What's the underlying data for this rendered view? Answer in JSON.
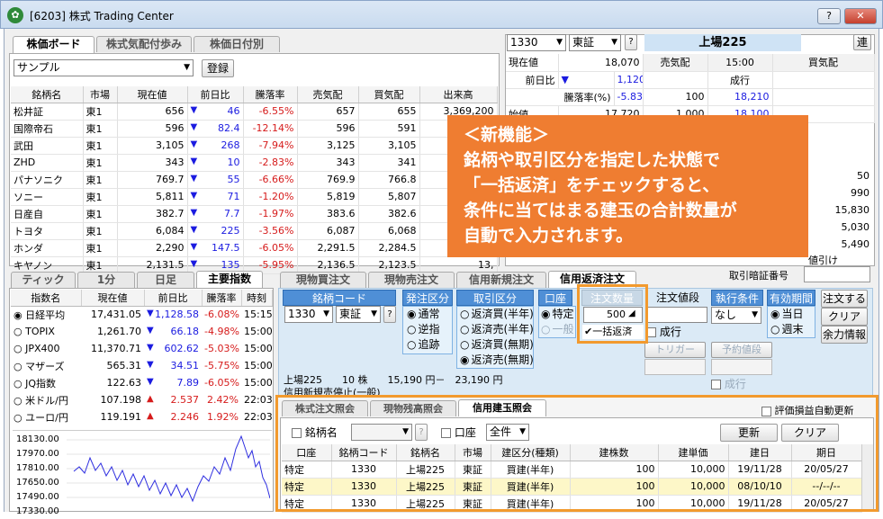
{
  "window": {
    "title": "[6203] 株式 Trading Center",
    "help": "?",
    "close": "✕"
  },
  "top_tabs": [
    "株価ボード",
    "株式気配付歩み",
    "株価日付別"
  ],
  "board": {
    "select": "サンプル",
    "register": "登録",
    "headers": [
      "銘柄名",
      "市場",
      "現在値",
      "前日比",
      "騰落率",
      "売気配",
      "買気配",
      "出来高"
    ],
    "rows": [
      [
        "松井証",
        "東1",
        "656",
        "▼",
        "46",
        "-6.55%",
        "657",
        "655",
        "3,369,200"
      ],
      [
        "国際帝石",
        "東1",
        "596",
        "▼",
        "82.4",
        "-12.14%",
        "596",
        "591",
        "28,"
      ],
      [
        "武田",
        "東1",
        "3,105",
        "▼",
        "268",
        "-7.94%",
        "3,125",
        "3,105",
        "19,"
      ],
      [
        "ZHD",
        "東1",
        "343",
        "▼",
        "10",
        "-2.83%",
        "343",
        "341",
        "37,"
      ],
      [
        "パナソニク",
        "東1",
        "769.7",
        "▼",
        "55",
        "-6.66%",
        "769.9",
        "766.8",
        "20,"
      ],
      [
        "ソニー",
        "東1",
        "5,811",
        "▼",
        "71",
        "-1.20%",
        "5,819",
        "5,807",
        "26,"
      ],
      [
        "日産自",
        "東1",
        "382.7",
        "▼",
        "7.7",
        "-1.97%",
        "383.6",
        "382.6",
        "50,"
      ],
      [
        "トヨタ",
        "東1",
        "6,084",
        "▼",
        "225",
        "-3.56%",
        "6,087",
        "6,068",
        "15,"
      ],
      [
        "ホンダ",
        "東1",
        "2,290",
        "▼",
        "147.5",
        "-6.05%",
        "2,291.5",
        "2,284.5",
        "14,"
      ],
      [
        "キヤノン",
        "東1",
        "2,131.5",
        "▼",
        "135",
        "-5.95%",
        "2,136.5",
        "2,123.5",
        "13,"
      ]
    ]
  },
  "quote": {
    "code": "1330",
    "market": "東証",
    "q": "?",
    "name": "上場225",
    "ren": "連",
    "h_cur": "現在値",
    "cur": "18,070",
    "sell_hdr": "売気配",
    "time": "15:00",
    "buy_hdr": "買気配",
    "prev_lbl": "前日比",
    "prev_mark": "▼",
    "prev": "1,120",
    "nari": "成行",
    "rate_lbl": "騰落率(%)",
    "rate": "-5.83%",
    "q1": "100",
    "p1": "18,210",
    "open_lbl": "始値",
    "open": "17,720",
    "q2": "1,000",
    "p2": "18,100",
    "right_vals": [
      "50",
      "990",
      "15,830",
      "5,030",
      "5,490"
    ],
    "hikinuke": "値引け"
  },
  "bottom_left": {
    "tabs": [
      "ティック",
      "1分",
      "日足",
      "主要指数"
    ],
    "headers": [
      "指数名",
      "現在値",
      "前日比",
      "騰落率",
      "時刻"
    ],
    "rows": [
      [
        "日経平均",
        "17,431.05",
        "▼",
        "1,128.58",
        "-6.08%",
        "15:15"
      ],
      [
        "TOPIX",
        "1,261.70",
        "▼",
        "66.18",
        "-4.98%",
        "15:00"
      ],
      [
        "JPX400",
        "11,370.71",
        "▼",
        "602.62",
        "-5.03%",
        "15:00"
      ],
      [
        "マザーズ",
        "565.31",
        "▼",
        "34.51",
        "-5.75%",
        "15:00"
      ],
      [
        "JQ指数",
        "122.63",
        "▼",
        "7.89",
        "-6.05%",
        "15:00"
      ],
      [
        "米ドル/円",
        "107.198",
        "▲",
        "2.537",
        "2.42%",
        "22:03"
      ],
      [
        "ユーロ/円",
        "119.191",
        "▲",
        "2.246",
        "1.92%",
        "22:03"
      ]
    ],
    "axis": [
      "18130.00",
      "17970.00",
      "17810.00",
      "17650.00",
      "17490.00",
      "17330.00"
    ]
  },
  "order": {
    "tabs": [
      "現物買注文",
      "現物売注文",
      "信用新規注文",
      "信用返済注文"
    ],
    "pin_label": "取引暗証番号",
    "meigara_hdr": "銘柄コード",
    "code": "1330",
    "market": "東証",
    "q": "?",
    "hatchu_hdr": "発注区分",
    "hatchu": [
      "通常",
      "逆指",
      "追跡"
    ],
    "torihiki_hdr": "取引区分",
    "torihiki": [
      "返済買(半年)",
      "返済売(半年)",
      "返済買(無期)",
      "返済売(無期)"
    ],
    "koza_hdr": "口座",
    "koza": [
      "特定",
      "一般"
    ],
    "qty_hdr": "注文数量",
    "qty": "500",
    "ikkatsu": "一括返済",
    "price_hdr": "注文値段",
    "nariyuki": "成行",
    "trigger": "トリガー",
    "yoyaku": "予約値段",
    "nariyuki2": "成行",
    "cond_hdr": "執行条件",
    "cond": "なし",
    "period_hdr": "有効期間",
    "period": [
      "当日",
      "週末"
    ],
    "order_btn": "注文する",
    "clear_btn": "クリア",
    "yoryoku_btn": "余力情報",
    "info1": "上場225　　10 株　　15,190 円－　23,190 円",
    "info2": "信用新規売停止(一般)"
  },
  "inquiry": {
    "tabs": [
      "株式注文照会",
      "現物残高照会",
      "信用建玉照会"
    ],
    "auto_update": "評価損益自動更新",
    "meigara_lbl": "銘柄名",
    "q": "?",
    "koza_lbl": "口座",
    "koza_val": "全件",
    "update_btn": "更新",
    "clear_btn": "クリア",
    "headers": [
      "口座",
      "銘柄コード",
      "銘柄名",
      "市場",
      "建区分(種類)",
      "建株数",
      "建単価",
      "建日",
      "期日"
    ],
    "rows": [
      [
        "特定",
        "1330",
        "上場225",
        "東証",
        "買建(半年)",
        "100",
        "10,000",
        "19/11/28",
        "20/05/27"
      ],
      [
        "特定",
        "1330",
        "上場225",
        "東証",
        "買建(半年)",
        "100",
        "10,000",
        "08/10/10",
        "--/--/--"
      ],
      [
        "特定",
        "1330",
        "上場225",
        "東証",
        "買建(半年)",
        "100",
        "10,000",
        "19/11/28",
        "20/05/27"
      ]
    ]
  },
  "callout": {
    "lines": [
      "＜新機能＞",
      "銘柄や取引区分を指定した状態で",
      "「一括返済」をチェックすると、",
      "条件に当てはまる建玉の合計数量が",
      "自動で入力されます。"
    ]
  },
  "colors": {
    "accent_orange": "#ef7d31",
    "highlight_border": "#f29a2e",
    "down_blue": "#1b1be0",
    "up_red": "#d61b1b",
    "header_blue": "#4f8fd6"
  }
}
